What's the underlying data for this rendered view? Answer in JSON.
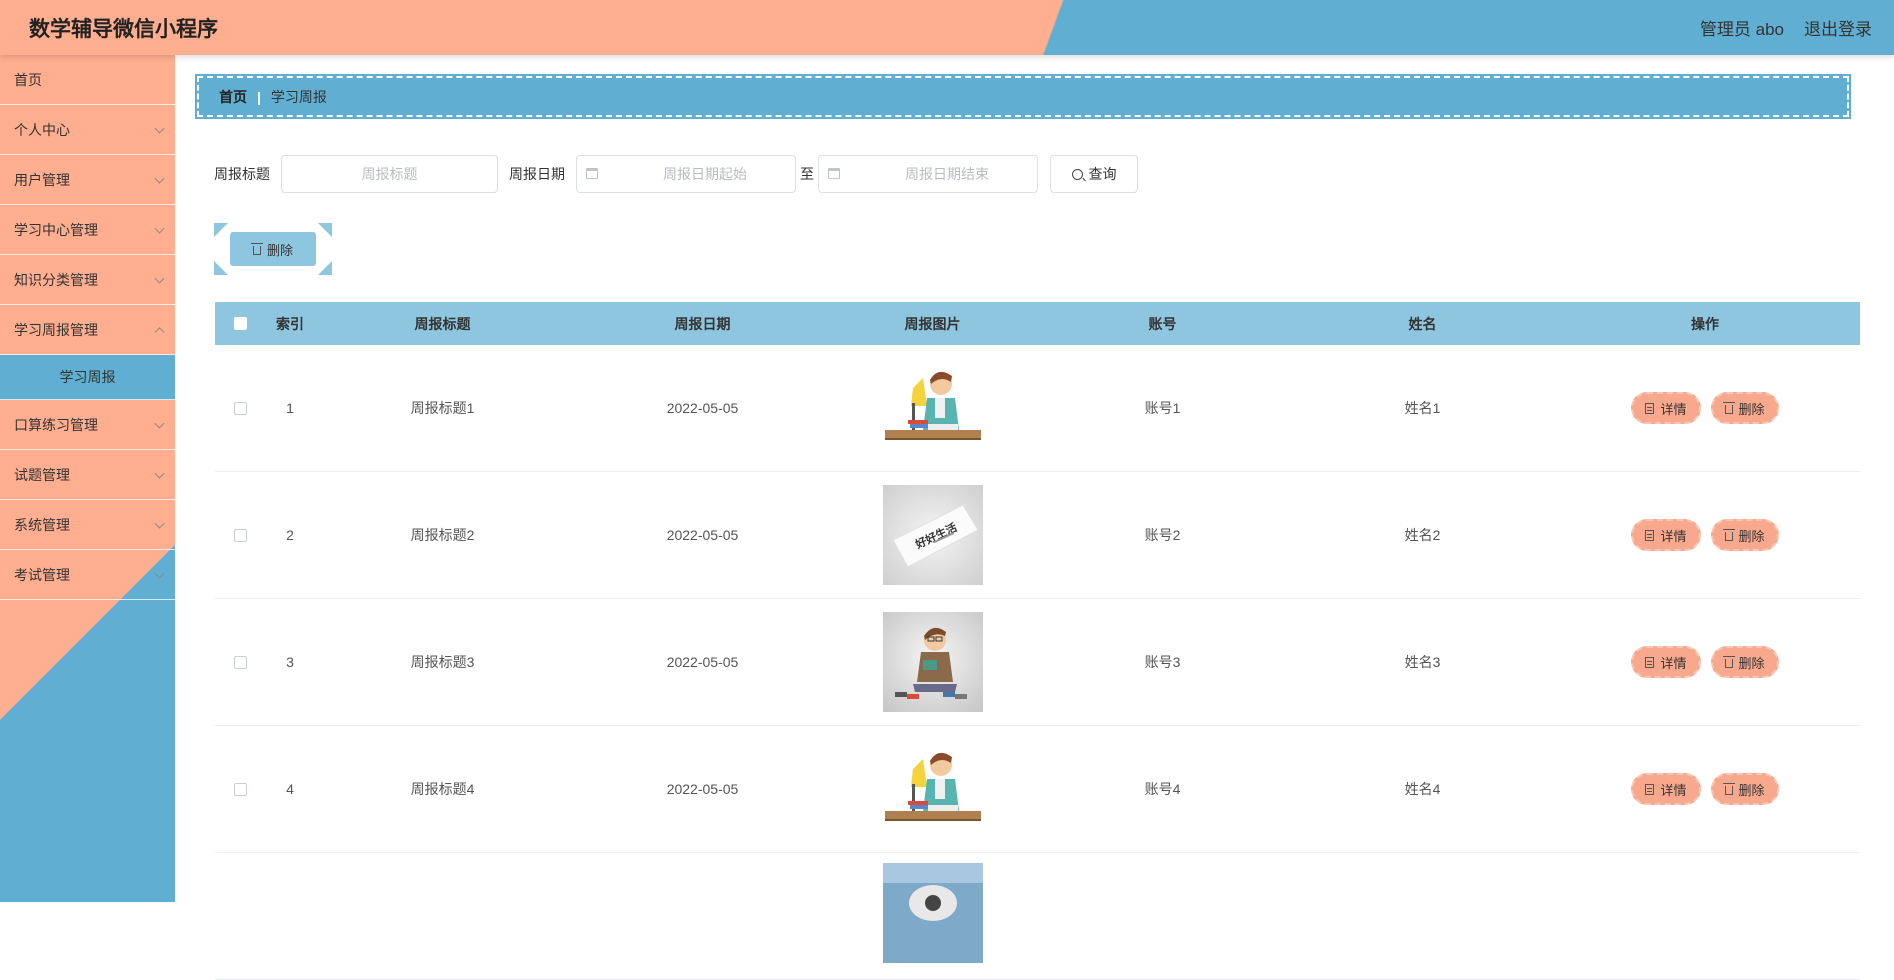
{
  "header": {
    "app_title": "数学辅导微信小程序",
    "admin_label": "管理员 abo",
    "logout_label": "退出登录"
  },
  "sidebar": {
    "items": [
      {
        "label": "首页",
        "has_children": false
      },
      {
        "label": "个人中心",
        "has_children": true
      },
      {
        "label": "用户管理",
        "has_children": true
      },
      {
        "label": "学习中心管理",
        "has_children": true
      },
      {
        "label": "知识分类管理",
        "has_children": true
      },
      {
        "label": "学习周报管理",
        "has_children": true,
        "expanded": true
      },
      {
        "label": "口算练习管理",
        "has_children": true
      },
      {
        "label": "试题管理",
        "has_children": true
      },
      {
        "label": "系统管理",
        "has_children": true
      },
      {
        "label": "考试管理",
        "has_children": true
      }
    ],
    "active_subitem": "学习周报"
  },
  "breadcrumb": {
    "home": "首页",
    "separator": "|",
    "current": "学习周报"
  },
  "search": {
    "title_label": "周报标题",
    "title_placeholder": "周报标题",
    "title_value": "",
    "date_label": "周报日期",
    "date_start_placeholder": "周报日期起始",
    "date_end_placeholder": "周报日期结束",
    "to_label": "至",
    "query_label": "查询"
  },
  "actions": {
    "batch_delete_label": "删除"
  },
  "table": {
    "columns": [
      "索引",
      "周报标题",
      "周报日期",
      "周报图片",
      "账号",
      "姓名",
      "操作"
    ],
    "rows": [
      {
        "index": "1",
        "title": "周报标题1",
        "date": "2022-05-05",
        "image": "studying-boy-illustration",
        "account": "账号1",
        "name": "姓名1"
      },
      {
        "index": "2",
        "title": "周报标题2",
        "date": "2022-05-05",
        "image": "good-life-paper",
        "account": "账号2",
        "name": "姓名2"
      },
      {
        "index": "3",
        "title": "周报标题3",
        "date": "2022-05-05",
        "image": "reading-man-illustration",
        "account": "账号3",
        "name": "姓名3"
      },
      {
        "index": "4",
        "title": "周报标题4",
        "date": "2022-05-05",
        "image": "studying-boy-illustration",
        "account": "账号4",
        "name": "姓名4"
      }
    ],
    "detail_label": "详情",
    "delete_label": "删除",
    "thumb_text": "好好生活"
  },
  "colors": {
    "salmon": "#ffae90",
    "blue": "#60afd2",
    "light_blue": "#8ec6e0",
    "button_salmon": "#f8a98d"
  }
}
